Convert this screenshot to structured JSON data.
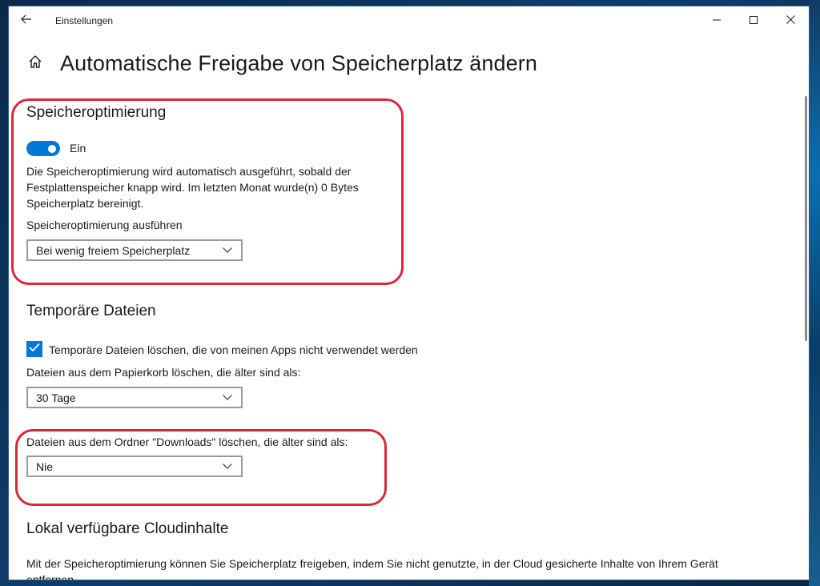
{
  "window": {
    "title": "Einstellungen"
  },
  "page": {
    "title": "Automatische Freigabe von Speicherplatz ändern"
  },
  "storage_sense": {
    "heading": "Speicheroptimierung",
    "toggle_state_label": "Ein",
    "toggle_on": true,
    "description": "Die Speicheroptimierung wird automatisch ausgeführt, sobald der Festplattenspeicher knapp wird. Im letzten Monat wurde(n) 0 Bytes Speicherplatz bereinigt.",
    "description_lines": [
      "Die Speicheroptimierung wird automatisch ausgeführt, sobald der",
      "Festplattenspeicher knapp wird. Im letzten Monat wurde(n) 0 Bytes",
      "Speicherplatz bereinigt."
    ],
    "run_label": "Speicheroptimierung ausführen",
    "run_value": "Bei wenig freiem Speicherplatz"
  },
  "temp_files": {
    "heading": "Temporäre Dateien",
    "checkbox_label": "Temporäre Dateien löschen, die von meinen Apps nicht verwendet werden",
    "checkbox_checked": true,
    "recycle_label": "Dateien aus dem Papierkorb löschen, die älter sind als:",
    "recycle_value": "30 Tage",
    "downloads_label": "Dateien aus dem Ordner \"Downloads\" löschen, die älter sind als:",
    "downloads_value": "Nie"
  },
  "cloud": {
    "heading": "Lokal verfügbare Cloudinhalte",
    "description_line1": "Mit der Speicheroptimierung können Sie Speicherplatz freigeben, indem Sie nicht genutzte, in der Cloud gesicherte Inhalte von Ihrem Gerät",
    "description_line2": "entfernen."
  },
  "colors": {
    "accent": "#0078d7",
    "highlight": "#d8283a"
  },
  "icons": {
    "back": "back-arrow-icon",
    "home": "home-icon",
    "minimize": "minimize-icon",
    "maximize": "maximize-icon",
    "close": "close-icon",
    "dropdown": "chevron-down-icon",
    "check": "checkmark-icon"
  }
}
